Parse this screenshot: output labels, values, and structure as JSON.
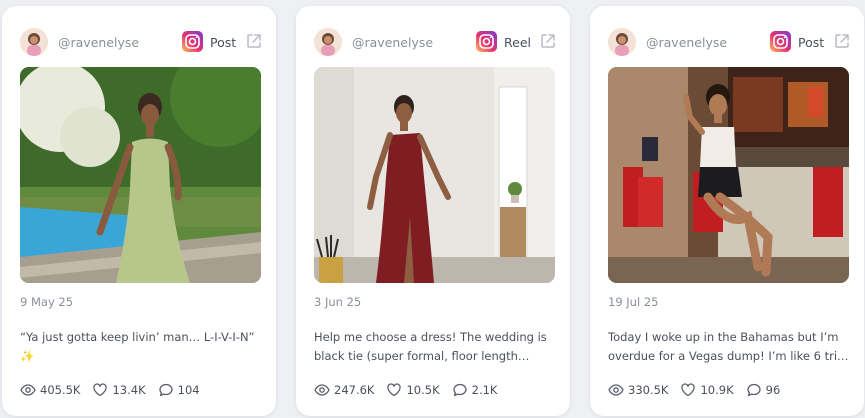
{
  "cards": [
    {
      "handle": "@ravenelyse",
      "type": "Post",
      "date": "9 May 25",
      "caption": "“Ya just gotta keep livin’ man… L-I-V-I-N” ✨",
      "views": "405.5K",
      "likes": "13.4K",
      "comments": "104"
    },
    {
      "handle": "@ravenelyse",
      "type": "Reel",
      "date": "3 Jun 25",
      "caption": "Help me choose a dress! The wedding is black tie (super formal, floor length…",
      "views": "247.6K",
      "likes": "10.5K",
      "comments": "2.1K"
    },
    {
      "handle": "@ravenelyse",
      "type": "Post",
      "date": "19 Jul 25",
      "caption": "Today I woke up in the Bahamas but I’m overdue for a Vegas dump! I’m like 6 tri…",
      "views": "330.5K",
      "likes": "10.9K",
      "comments": "96"
    }
  ],
  "icons": {
    "platform": "instagram-icon",
    "open": "external-link-icon",
    "views": "eye-icon",
    "likes": "heart-icon",
    "comments": "comment-icon"
  },
  "colors": {
    "background": "#eef0f4",
    "card": "#ffffff",
    "muted_text": "#8a8f99",
    "body_text": "#4b505c"
  }
}
